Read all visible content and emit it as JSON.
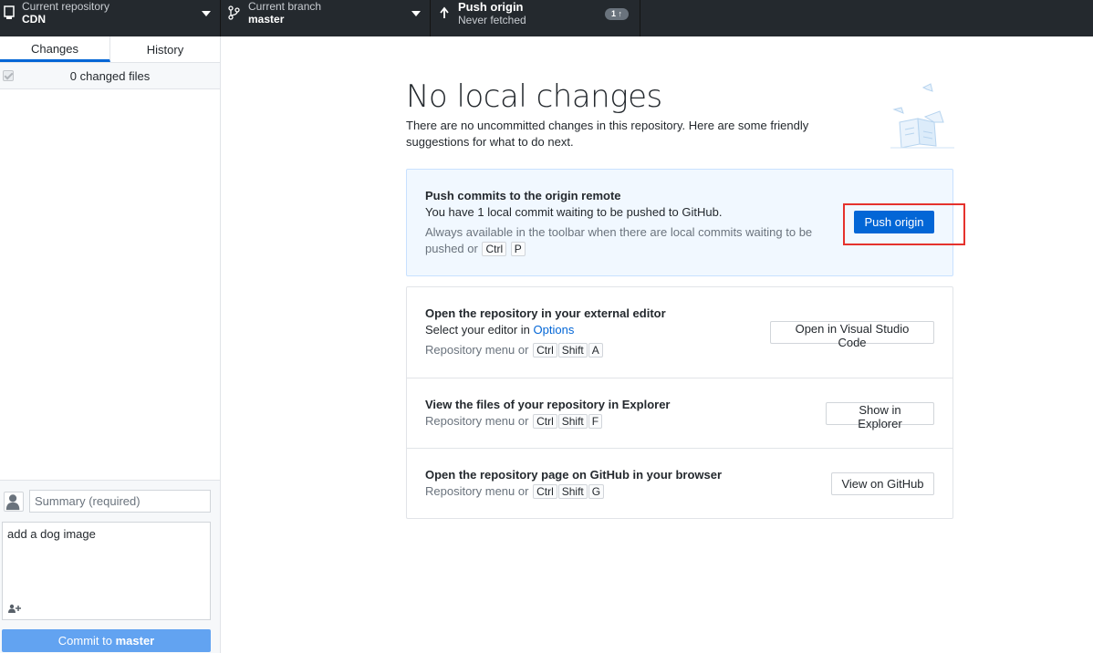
{
  "toolbar": {
    "repository": {
      "label": "Current repository",
      "value": "CDN"
    },
    "branch": {
      "label": "Current branch",
      "value": "master"
    },
    "push": {
      "label": "Push origin",
      "status": "Never fetched",
      "badge": "1 ↑"
    }
  },
  "sidebar": {
    "tabs": [
      {
        "label": "Changes",
        "selected": true
      },
      {
        "label": "History",
        "selected": false
      }
    ],
    "changed_files": "0 changed files",
    "commit": {
      "summary_placeholder": "Summary (required)",
      "description": "add a dog image",
      "button_prefix": "Commit to ",
      "button_branch": "master"
    }
  },
  "main": {
    "title": "No local changes",
    "subtitle": "There are no uncommitted changes in this repository. Here are some friendly suggestions for what to do next.",
    "push_card": {
      "title": "Push commits to the origin remote",
      "description": "You have 1 local commit waiting to be pushed to GitHub.",
      "hint": "Always available in the toolbar when there are local commits waiting to be pushed or",
      "keys": [
        "Ctrl",
        "P"
      ],
      "button": "Push origin"
    },
    "editor": {
      "title": "Open the repository in your external editor",
      "description_prefix": "Select your editor in ",
      "description_link": "Options",
      "hint": "Repository menu or",
      "keys": [
        "Ctrl",
        "Shift",
        "A"
      ],
      "button": "Open in Visual Studio Code"
    },
    "explorer": {
      "title": "View the files of your repository in Explorer",
      "hint": "Repository menu or",
      "keys": [
        "Ctrl",
        "Shift",
        "F"
      ],
      "button": "Show in Explorer"
    },
    "github": {
      "title": "Open the repository page on GitHub in your browser",
      "hint": "Repository menu or",
      "keys": [
        "Ctrl",
        "Shift",
        "G"
      ],
      "button": "View on GitHub"
    }
  },
  "colors": {
    "accent": "#0366d6",
    "toolbar_bg": "#24292e",
    "highlight": "#e5322d"
  }
}
